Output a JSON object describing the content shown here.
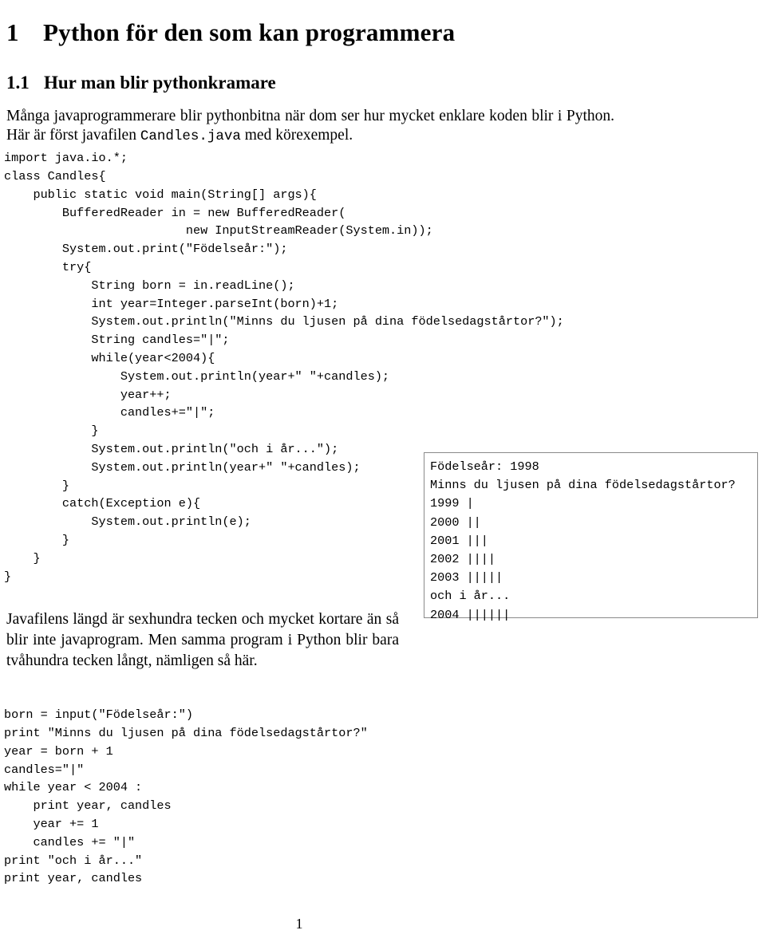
{
  "document": {
    "heading1": {
      "number": "1",
      "text": "Python för den som kan programmera"
    },
    "heading2": {
      "number": "1.1",
      "text": "Hur man blir pythonkramare"
    },
    "intro_paragraph": {
      "before_code": "Många javaprogrammerare blir pythonbitna när dom ser hur mycket enklare koden blir i Python. Här är först javafilen ",
      "inline_code": "Candles.java",
      "after_code": " med körexempel."
    },
    "java_code": "import java.io.*;\nclass Candles{\n    public static void main(String[] args){\n        BufferedReader in = new BufferedReader(\n                         new InputStreamReader(System.in));\n        System.out.print(\"Födelseår:\");\n        try{\n            String born = in.readLine();\n            int year=Integer.parseInt(born)+1;\n            System.out.println(\"Minns du ljusen på dina födelsedagstårtor?\");\n            String candles=\"|\";\n            while(year<2004){\n                System.out.println(year+\" \"+candles);\n                year++;\n                candles+=\"|\";\n            }\n            System.out.println(\"och i år...\");\n            System.out.println(year+\" \"+candles);\n        }\n        catch(Exception e){\n            System.out.println(e);\n        }\n    }\n}",
    "output_box": {
      "lines": [
        "Födelseår: 1998",
        "Minns du ljusen på dina födelsedagstårtor?",
        "1999 |",
        "2000 ||",
        "2001 |||",
        "2002 ||||",
        "2003 |||||",
        "och i år...",
        "2004 ||||||"
      ]
    },
    "javafile_paragraph": "Javafilens längd är sexhundra tecken och mycket kortare än så blir inte javaprogram. Men samma program i Python blir bara tvåhundra tecken långt, nämligen så här.",
    "python_code": "born = input(\"Födelseår:\")\nprint \"Minns du ljusen på dina födelsedagstårtor?\"\nyear = born + 1\ncandles=\"|\"\nwhile year < 2004 :\n    print year, candles\n    year += 1\n    candles += \"|\"\nprint \"och i år...\"\nprint year, candles",
    "page_number": "1"
  }
}
